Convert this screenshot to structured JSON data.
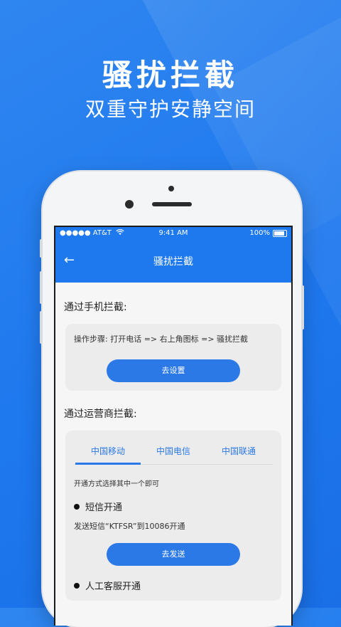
{
  "hero": {
    "title": "骚扰拦截",
    "subtitle": "双重守护安静空间"
  },
  "statusbar": {
    "carrier": "●●●●● AT&T",
    "time": "9:41 AM",
    "battery": "100%"
  },
  "appbar": {
    "title": "骚扰拦截",
    "back_icon": "←"
  },
  "phone_block": {
    "title": "通过手机拦截:",
    "steps": "操作步骤: 打开电话 => 右上角图标 => 骚扰拦截",
    "button": "去设置"
  },
  "carrier_block": {
    "title": "通过运营商拦截:",
    "tabs": [
      "中国移动",
      "中国电信",
      "中国联通"
    ],
    "hint": "开通方式选择其中一个即可",
    "sms": {
      "title": "短信开通",
      "desc": "发送短信“KTFSR”到10086开通",
      "button": "去发送"
    },
    "manual": {
      "title": "人工客服开通"
    }
  },
  "colors": {
    "primary": "#1e78ee",
    "button": "#2b79e7"
  }
}
